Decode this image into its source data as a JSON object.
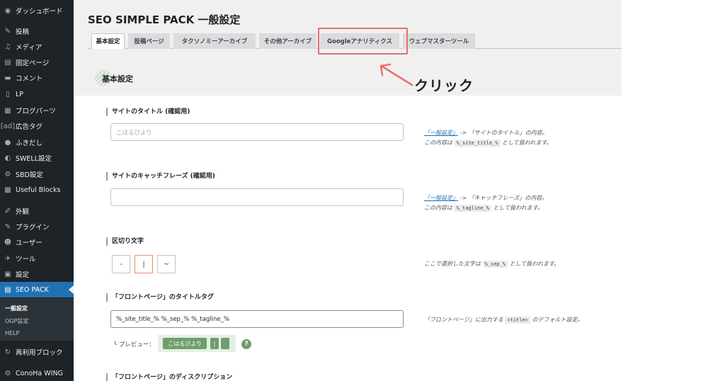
{
  "sidebar": {
    "items": [
      {
        "label": "ダッシュボード",
        "icon": "dashboard-icon",
        "glyph": "◉"
      },
      {
        "label": "投稿",
        "icon": "pin-icon",
        "glyph": "✎"
      },
      {
        "label": "メディア",
        "icon": "media-icon",
        "glyph": "♫"
      },
      {
        "label": "固定ページ",
        "icon": "page-icon",
        "glyph": "▤"
      },
      {
        "label": "コメント",
        "icon": "comment-icon",
        "glyph": "▬"
      },
      {
        "label": "LP",
        "icon": "lp-icon",
        "glyph": "▯"
      },
      {
        "label": "ブログパーツ",
        "icon": "blog-parts-icon",
        "glyph": "▦"
      },
      {
        "label": "広告タグ",
        "icon": "ad-tag-icon",
        "glyph": "[ad]"
      },
      {
        "label": "ふきだし",
        "icon": "speech-bubble-icon",
        "glyph": "●"
      },
      {
        "label": "SWELL設定",
        "icon": "swell-icon",
        "glyph": "◐"
      },
      {
        "label": "SBD設定",
        "icon": "gear-icon",
        "glyph": "⚙"
      },
      {
        "label": "Useful Blocks",
        "icon": "blocks-icon",
        "glyph": "▩"
      },
      {
        "label": "外観",
        "icon": "appearance-icon",
        "glyph": "✐"
      },
      {
        "label": "プラグイン",
        "icon": "plugin-icon",
        "glyph": "✎"
      },
      {
        "label": "ユーザー",
        "icon": "user-icon",
        "glyph": "☻"
      },
      {
        "label": "ツール",
        "icon": "wrench-icon",
        "glyph": "✈"
      },
      {
        "label": "設定",
        "icon": "settings-icon",
        "glyph": "▣"
      },
      {
        "label": "SEO PACK",
        "icon": "seo-pack-icon",
        "glyph": "▤"
      },
      {
        "label": "再利用ブロック",
        "icon": "reuse-block-icon",
        "glyph": "↻"
      },
      {
        "label": "ConoHa WING",
        "icon": "conoha-icon",
        "glyph": "⚙"
      }
    ],
    "submenu": [
      "一般設定",
      "OGP設定",
      "HELP"
    ]
  },
  "page": {
    "title": "SEO SIMPLE PACK 一般設定"
  },
  "tabs": [
    "基本設定",
    "投稿ページ",
    "タクソノミーアーカイブ",
    "その他アーカイブ",
    "Googleアナリティクス",
    "ウェブマスターツール"
  ],
  "annotation": {
    "click_label": "クリック",
    "highlight_color": "#e8706b"
  },
  "section": {
    "heading": "基本設定"
  },
  "fields": {
    "site_title": {
      "label": "サイトのタイトル (確認用)",
      "placeholder": "こはるびより",
      "help_link": "「一般設定」",
      "help_line1": " -> 「サイトのタイトル」の内容。",
      "help_line2_pre": "この内容は ",
      "help_code": "%_site_title_%",
      "help_line2_post": " として扱われます。"
    },
    "tagline": {
      "label": "サイトのキャッチフレーズ (確認用)",
      "value": "",
      "help_link": "「一般設定」",
      "help_line1": " -> 「キャッチフレーズ」の内容。",
      "help_line2_pre": "この内容は ",
      "help_code": "%_tagline_%",
      "help_line2_post": " として扱われます。"
    },
    "separator": {
      "label": "区切り文字",
      "options": [
        "-",
        "|",
        "~"
      ],
      "selected": "|",
      "help_pre": "ここで選択した文字は ",
      "help_code": "%_sep_%",
      "help_post": " として扱われます。"
    },
    "front_title": {
      "label": "「フロントページ」のタイトルタグ",
      "value": "%_site_title_% %_sep_% %_tagline_%",
      "help_pre": "「フロントページ」に出力する ",
      "help_code": "<title>",
      "help_post": " のデフォルト設定。",
      "preview_label": "└ プレビュー：",
      "preview_chips": [
        "こはるびより",
        "|",
        ""
      ],
      "help_icon": "?"
    },
    "front_description": {
      "label": "「フロントページ」のディスクリプション"
    }
  },
  "colors": {
    "sidebar_bg": "#1d2327",
    "active_menu": "#2271b1",
    "accent_green": "#6f9e6d"
  }
}
